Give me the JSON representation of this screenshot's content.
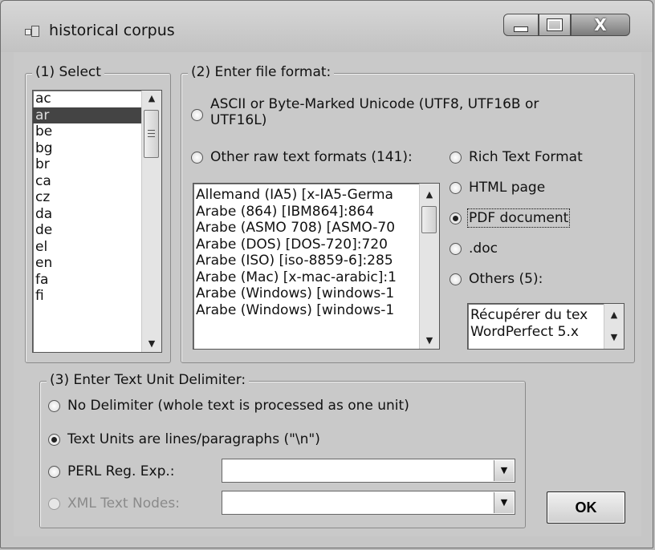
{
  "window": {
    "title": "historical corpus"
  },
  "select_group": {
    "legend": "(1) Select",
    "items": [
      "ac",
      "ar",
      "be",
      "bg",
      "br",
      "ca",
      "cz",
      "da",
      "de",
      "el",
      "en",
      "fa",
      "fi"
    ],
    "selected": "ar"
  },
  "format_group": {
    "legend": "(2) Enter file format:",
    "ascii_label_line1": "ASCII or Byte-Marked Unicode (UTF8, UTF16B or",
    "ascii_label_line2": "UTF16L)",
    "other_raw_label": "Other raw text formats (141):",
    "encodings": [
      "Allemand (IA5) [x-IA5-Germa",
      "Arabe (864) [IBM864]:864",
      "Arabe (ASMO 708) [ASMO-70",
      "Arabe (DOS) [DOS-720]:720",
      "Arabe (ISO) [iso-8859-6]:285",
      "Arabe (Mac) [x-mac-arabic]:1",
      "Arabe (Windows) [windows-1",
      "Arabe (Windows) [windows-1"
    ],
    "rtf_label": "Rich Text Format",
    "html_label": "HTML page",
    "pdf_label": "PDF document",
    "doc_label": ".doc",
    "others_label": "Others (5):",
    "others_items": [
      "Récupérer du tex",
      "WordPerfect 5.x"
    ],
    "selected_format": "PDF document"
  },
  "delimiter_group": {
    "legend": "(3) Enter Text Unit Delimiter:",
    "no_delim_label": "No Delimiter (whole text is processed as one unit)",
    "lines_label": "Text Units are lines/paragraphs (\"\\n\")",
    "perl_label": "PERL Reg. Exp.:",
    "xml_label": "XML Text Nodes:",
    "perl_value": "",
    "xml_value": "",
    "selected": "Text Units are lines/paragraphs (\"\\n\")"
  },
  "ok_label": "OK"
}
